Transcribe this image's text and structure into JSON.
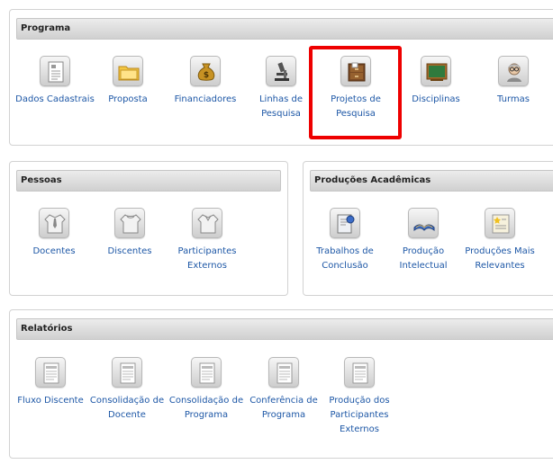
{
  "programa": {
    "title": "Programa",
    "items": [
      {
        "label": "Dados Cadastrais",
        "icon": "document-form-icon"
      },
      {
        "label": "Proposta",
        "icon": "folder-icon"
      },
      {
        "label": "Financiadores",
        "icon": "money-bag-icon"
      },
      {
        "label": "Linhas de Pesquisa",
        "icon": "microscope-icon"
      },
      {
        "label": "Projetos de Pesquisa",
        "icon": "file-cabinet-icon"
      },
      {
        "label": "Disciplinas",
        "icon": "chalkboard-icon"
      },
      {
        "label": "Turmas",
        "icon": "teacher-icon"
      }
    ]
  },
  "pessoas": {
    "title": "Pessoas",
    "items": [
      {
        "label": "Docentes",
        "icon": "shirt-tie-icon"
      },
      {
        "label": "Discentes",
        "icon": "shirt-icon"
      },
      {
        "label": "Participantes Externos",
        "icon": "shirt-collar-icon"
      }
    ]
  },
  "producoes": {
    "title": "Produções Acadêmicas",
    "items": [
      {
        "label": "Trabalhos de Conclusão",
        "icon": "certificate-icon"
      },
      {
        "label": "Produção Intelectual",
        "icon": "open-book-icon"
      },
      {
        "label": "Produções Mais Relevantes",
        "icon": "star-document-icon"
      }
    ]
  },
  "relatorios": {
    "title": "Relatórios",
    "items": [
      {
        "label": "Fluxo Discente",
        "icon": "report-icon"
      },
      {
        "label": "Consolidação de Docente",
        "icon": "report-icon"
      },
      {
        "label": "Consolidação de Programa",
        "icon": "report-icon"
      },
      {
        "label": "Conferência de Programa",
        "icon": "report-icon"
      },
      {
        "label": "Produção dos Participantes Externos",
        "icon": "report-icon"
      }
    ]
  },
  "colors": {
    "link": "#1d57a6",
    "highlight": "#ee0000"
  }
}
